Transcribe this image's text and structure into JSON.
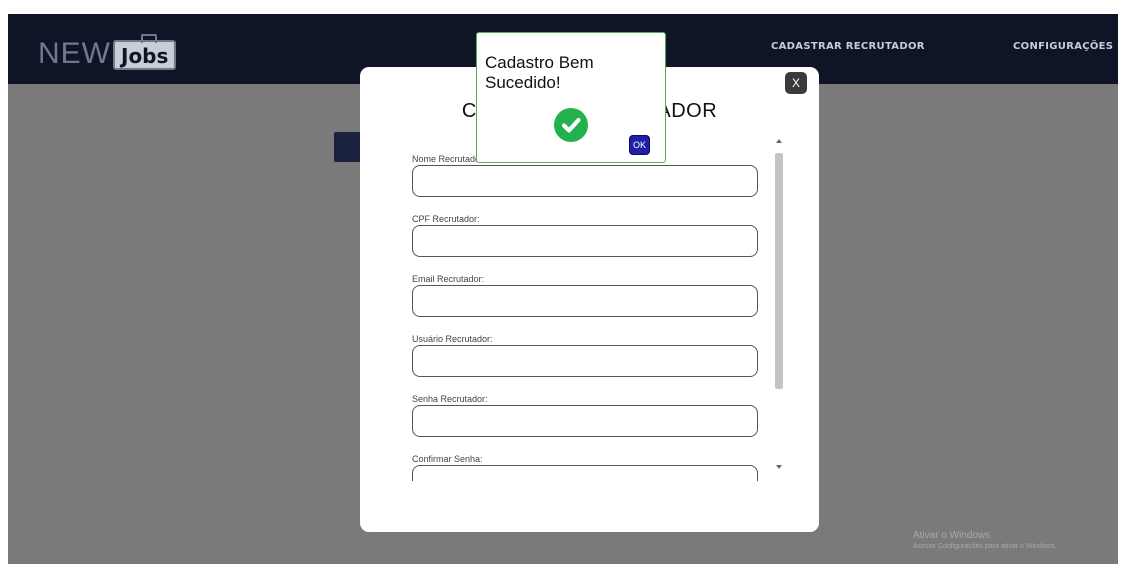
{
  "navbar": {
    "logo_new": "NEW",
    "logo_jobs": "Jobs",
    "links": [
      "CADASTRAR RECRUTADOR",
      "CONFIGURAÇÕES"
    ]
  },
  "modal": {
    "close_label": "X",
    "title": "C                              ADOR",
    "fields": [
      {
        "label": "Nome Recrutador:",
        "value": ""
      },
      {
        "label": "CPF Recrutador:",
        "value": ""
      },
      {
        "label": "Email Recrutador:",
        "value": ""
      },
      {
        "label": "Usuário Recrutador:",
        "value": ""
      },
      {
        "label": "Senha Recrutador:",
        "value": ""
      },
      {
        "label": "Confirmar Senha:",
        "value": ""
      }
    ]
  },
  "alert": {
    "title": "Cadastro Bem Sucedido!",
    "icon": "check-circle-icon",
    "ok_label": "OK",
    "border_color": "#4caf50",
    "icon_color": "#22b14c"
  },
  "watermark": {
    "title": "Ativar o Windows",
    "subtitle": "Acesse Configurações para ativar o Windows."
  },
  "colors": {
    "navbar": "#0f1427",
    "overlay": "#7a7a7a",
    "ok_button": "#1f1fa6"
  }
}
